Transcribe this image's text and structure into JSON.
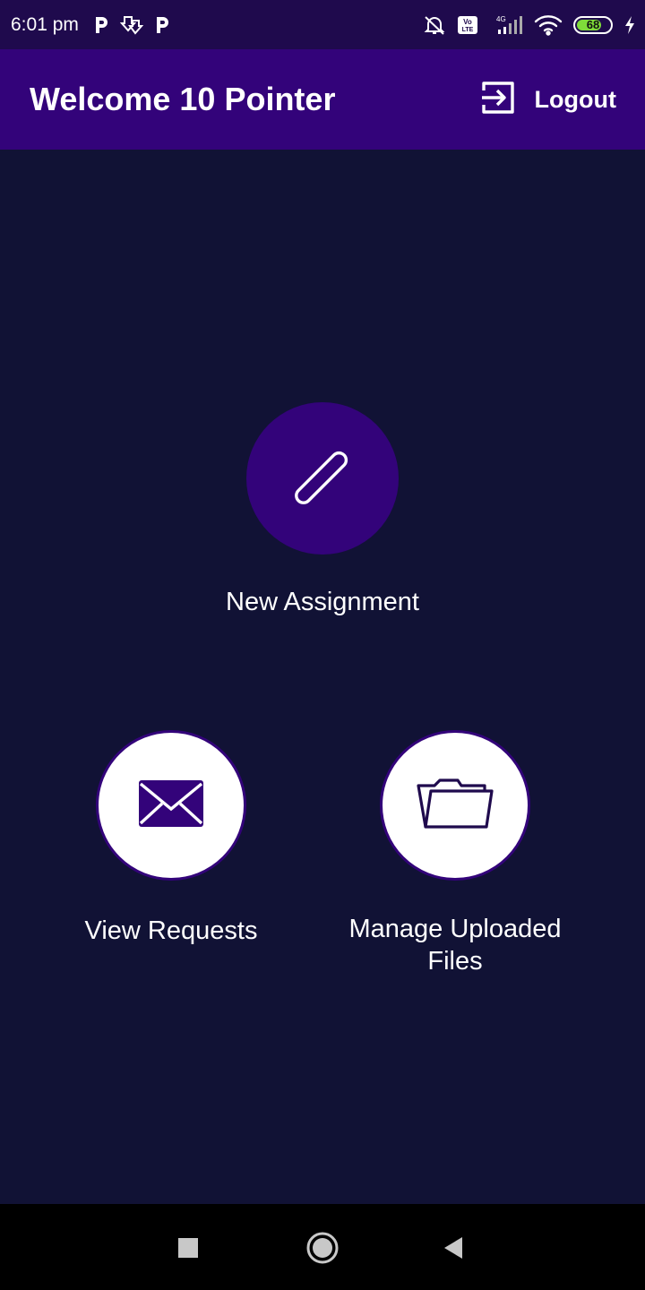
{
  "status_bar": {
    "time": "6:01 pm",
    "battery_level": "68",
    "network": "4G",
    "volte": "Vo LTE",
    "left_icons": [
      "parking-icon",
      "download-icon",
      "parking-icon"
    ],
    "right_icons": [
      "mute-icon",
      "volte-icon",
      "signal-icon",
      "wifi-icon",
      "battery-icon",
      "charging-icon"
    ]
  },
  "app_bar": {
    "title": "Welcome 10 Pointer",
    "logout_label": "Logout",
    "logout_icon": "logout-icon",
    "background": "#33037a"
  },
  "main": {
    "background": "#111235",
    "tiles": [
      {
        "label": "New Assignment",
        "icon": "paperclip-icon",
        "circle_color": "#33037a"
      },
      {
        "label": "View Requests",
        "icon": "mail-icon",
        "circle_color": "#ffffff"
      },
      {
        "label_line1": "Manage Uploaded",
        "label_line2": "Files",
        "icon": "folder-icon",
        "circle_color": "#ffffff"
      }
    ]
  },
  "nav_bar": {
    "buttons": [
      "recents-button",
      "home-button",
      "back-button"
    ]
  }
}
